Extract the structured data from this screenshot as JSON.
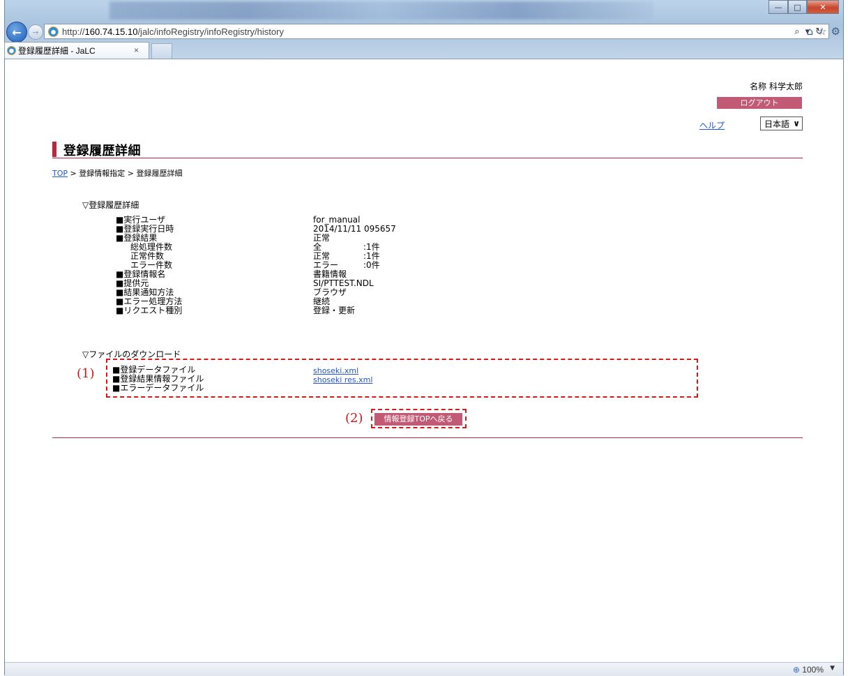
{
  "browser": {
    "url_prefix": "http://",
    "url_host": "160.74.15.10",
    "url_path": "/jalc/infoRegistry/infoRegistry/history",
    "tab_title": "登録履歴詳細 - JaLC",
    "tab_close": "×",
    "search_glyph": "⌕",
    "dropdown_glyph": "▾",
    "refresh_glyph": "↻",
    "back_glyph": "←",
    "forward_glyph": "→",
    "home_glyph": "⌂",
    "favorites_glyph": "☆",
    "tools_glyph": "⚙",
    "win_min": "—",
    "win_max": "□",
    "win_close": "✕",
    "zoom": "100%",
    "zoom_icon": "⊕",
    "zoom_arrow": "▼"
  },
  "header": {
    "user_name": "名称 科学太郎",
    "logout_label": "ログアウト",
    "help_label": "ヘルプ",
    "language": "日本語",
    "language_arrow": "∨"
  },
  "page": {
    "title": "登録履歴詳細",
    "breadcrumb": {
      "top": "TOP",
      "sep1": " > ",
      "item2": "登録情報指定",
      "sep2": " > ",
      "item3": "登録履歴詳細"
    },
    "detail_heading": "▽登録履歴詳細",
    "details": [
      {
        "label": "■実行ユーザ",
        "value": "for_manual"
      },
      {
        "label": "■登録実行日時",
        "value": "2014/11/11 095657"
      },
      {
        "label": "■登録結果",
        "value": "正常"
      },
      {
        "label": "総処理件数",
        "value": "全",
        "count": ":1件"
      },
      {
        "label": "正常件数",
        "value": "正常",
        "count": ":1件"
      },
      {
        "label": "エラー件数",
        "value": "エラー",
        "count": ":0件"
      },
      {
        "label": "■登録情報名",
        "value": "書籍情報"
      },
      {
        "label": "■提供元",
        "value": "SI/PTTEST.NDL"
      },
      {
        "label": "■結果通知方法",
        "value": "ブラウザ"
      },
      {
        "label": "■エラー処理方法",
        "value": "継続"
      },
      {
        "label": "■リクエスト種別",
        "value": "登録・更新"
      }
    ],
    "download_heading": "▽ファイルのダウンロード",
    "downloads": [
      {
        "label": "■登録データファイル",
        "link": "shoseki.xml"
      },
      {
        "label": "■登録結果情報ファイル",
        "link": "shoseki res.xml"
      },
      {
        "label": "■エラーデータファイル",
        "link": ""
      }
    ],
    "back_button_label": "情報登録TOPへ戻る",
    "callout_1": "(1)",
    "callout_2": "(2)"
  },
  "colors": {
    "accent": "#c0243b",
    "button_pink": "#c25a75",
    "link": "#2255cc",
    "annotation_red": "#d11a1a"
  }
}
